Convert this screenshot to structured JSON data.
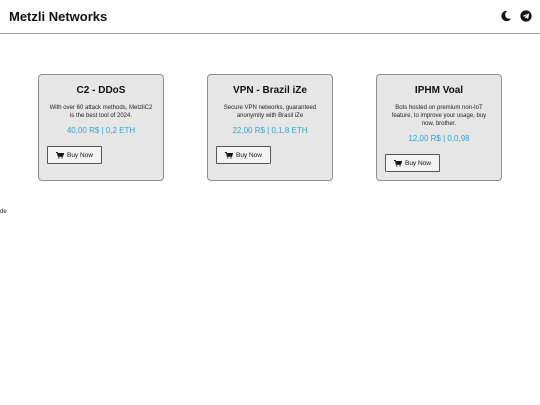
{
  "header": {
    "brand": "Metzli Networks",
    "icons": [
      "moon-icon",
      "telegram-icon"
    ]
  },
  "products": [
    {
      "title": "C2 - DDoS",
      "description": "With over 60 attack methods, MetzliC2 is the best tool of 2024.",
      "price": "40,00 R$ | 0,2 ETH",
      "button": "Buy Now"
    },
    {
      "title": "VPN - Brazil iZe",
      "description": "Secure VPN networks, guaranteed anonymity with Brasil iZe",
      "price": "22,00 R$ | 0,1,8 ETH",
      "button": "Buy Now"
    },
    {
      "title": "IPHM Voal",
      "description": "Bots hosted on premium non-IoT feature, to improve your usage, buy now, brother.",
      "price": "12,00 R$ | 0,0,98",
      "button": "Buy Now"
    }
  ],
  "side_text": "de",
  "colors": {
    "price": "#2fa3d6",
    "card_bg": "#e6e6e6"
  }
}
